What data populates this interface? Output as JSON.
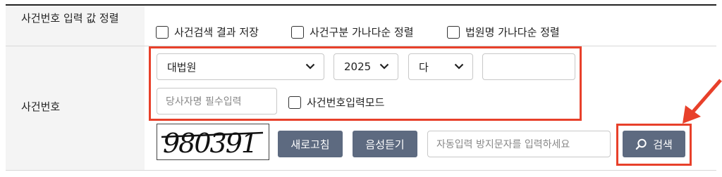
{
  "sort_row": {
    "label": "사건번호 입력 값 정렬",
    "options": [
      {
        "label": "사건검색 결과 저장",
        "checked": false
      },
      {
        "label": "사건구분 가나다순 정렬",
        "checked": false
      },
      {
        "label": "법원명 가나다순 정렬",
        "checked": false
      }
    ]
  },
  "case_row": {
    "label": "사건번호",
    "court_select": "대법원",
    "year_select": "2025",
    "type_select": "다",
    "number_input": "",
    "party_placeholder": "당사자명 필수입력",
    "input_mode_label": "사건번호입력모드",
    "captcha_text": "980391",
    "refresh_button": "새로고침",
    "audio_button": "음성듣기",
    "captcha_placeholder": "자동입력 방지문자를 입력하세요",
    "search_button": "검색"
  },
  "colors": {
    "highlight": "#e8402a",
    "button": "#5d6a80",
    "header_bg": "#f4f4f4"
  },
  "icons": [
    "chevron-down-icon",
    "search-icon",
    "arrow-icon"
  ]
}
